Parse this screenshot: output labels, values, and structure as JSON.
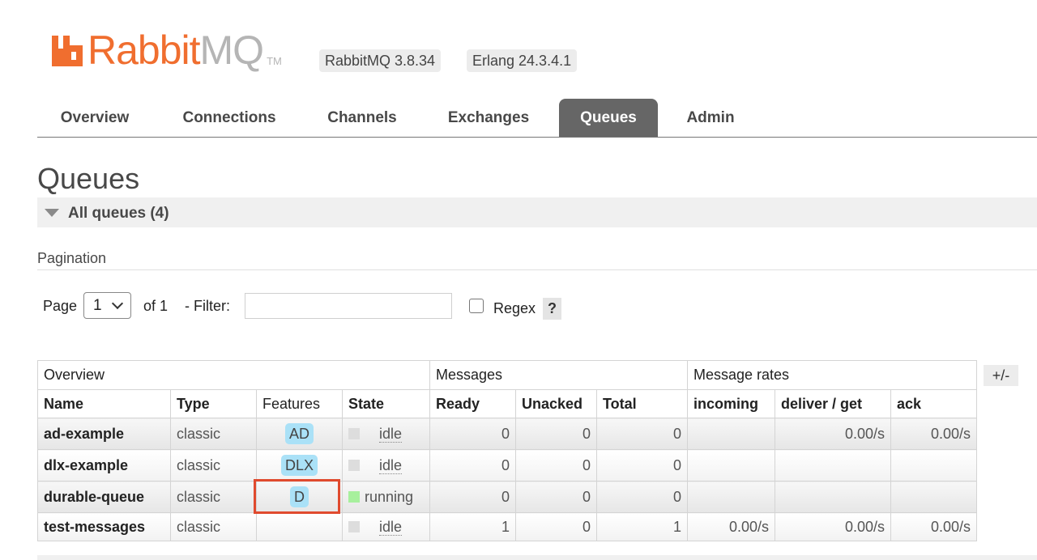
{
  "header": {
    "logo_rabbit": "Rabbit",
    "logo_mq": "MQ",
    "logo_tm": "TM",
    "rabbitmq_version": "RabbitMQ 3.8.34",
    "erlang_version": "Erlang 24.3.4.1"
  },
  "tabs": [
    {
      "label": "Overview",
      "active": false
    },
    {
      "label": "Connections",
      "active": false
    },
    {
      "label": "Channels",
      "active": false
    },
    {
      "label": "Exchanges",
      "active": false
    },
    {
      "label": "Queues",
      "active": true
    },
    {
      "label": "Admin",
      "active": false
    }
  ],
  "page_title": "Queues",
  "section_title": "All queues (4)",
  "pagination": {
    "label": "Pagination",
    "page_label": "Page",
    "page_value": "1",
    "of_label": "of 1",
    "filter_label": "- Filter:",
    "filter_value": "",
    "regex_label": "Regex",
    "regex_checked": false,
    "help_label": "?"
  },
  "table": {
    "groups": [
      "Overview",
      "Messages",
      "Message rates"
    ],
    "columns": [
      "Name",
      "Type",
      "Features",
      "State",
      "Ready",
      "Unacked",
      "Total",
      "incoming",
      "deliver / get",
      "ack"
    ],
    "plus_minus": "+/-",
    "rows": [
      {
        "name": "ad-example",
        "type": "classic",
        "feature": "AD",
        "state": "idle",
        "ready": "0",
        "unacked": "0",
        "total": "0",
        "incoming": "",
        "deliver_get": "0.00/s",
        "ack": "0.00/s"
      },
      {
        "name": "dlx-example",
        "type": "classic",
        "feature": "DLX",
        "state": "idle",
        "ready": "0",
        "unacked": "0",
        "total": "0",
        "incoming": "",
        "deliver_get": "",
        "ack": ""
      },
      {
        "name": "durable-queue",
        "type": "classic",
        "feature": "D",
        "state": "running",
        "ready": "0",
        "unacked": "0",
        "total": "0",
        "incoming": "",
        "deliver_get": "",
        "ack": ""
      },
      {
        "name": "test-messages",
        "type": "classic",
        "feature": "",
        "state": "idle",
        "ready": "1",
        "unacked": "0",
        "total": "1",
        "incoming": "0.00/s",
        "deliver_get": "0.00/s",
        "ack": "0.00/s"
      }
    ]
  },
  "colors": {
    "brand_orange": "#f06e2f",
    "active_tab": "#666666",
    "feature_badge": "#aae1f7",
    "state_running": "#a7f09d",
    "state_idle": "#dddddd",
    "highlight": "#e04a2e"
  },
  "icons": {
    "logo": "rabbit-logo-icon",
    "collapse": "triangle-down-icon",
    "select": "chevron-down-icon"
  }
}
